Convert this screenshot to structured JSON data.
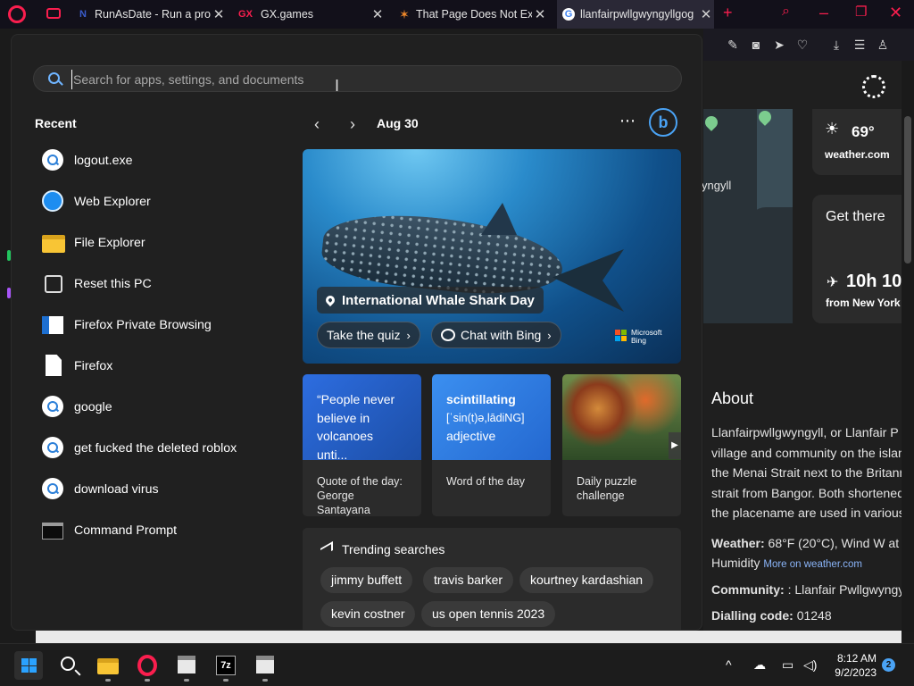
{
  "browser": {
    "tabs": [
      {
        "title": "RunAsDate - Run a prog",
        "favicon": "N",
        "favicon_color": "#3a5ccc"
      },
      {
        "title": "GX.games",
        "favicon": "GX",
        "favicon_color": "#fa1e4e"
      },
      {
        "title": "That Page Does Not Exis",
        "favicon": "✶",
        "favicon_color": "#f28a2a"
      },
      {
        "title": "llanfairpwllgwyngyllgog",
        "favicon": "G",
        "favicon_color": "#4285f4",
        "active": true
      }
    ],
    "new_tab": "+",
    "close": "✕"
  },
  "search": {
    "placeholder": "Search for apps, settings, and documents",
    "value": ""
  },
  "recent": {
    "title": "Recent",
    "items": [
      {
        "label": "logout.exe",
        "icon": "search-icon"
      },
      {
        "label": "Web Explorer",
        "icon": "web-explorer-icon"
      },
      {
        "label": "File Explorer",
        "icon": "folder-icon"
      },
      {
        "label": "Reset this PC",
        "icon": "reset-icon"
      },
      {
        "label": "Firefox Private Browsing",
        "icon": "app-icon"
      },
      {
        "label": "Firefox",
        "icon": "document-icon"
      },
      {
        "label": "google",
        "icon": "search-icon"
      },
      {
        "label": "get fucked the deleted roblox",
        "icon": "search-icon"
      },
      {
        "label": "download virus",
        "icon": "search-icon"
      },
      {
        "label": "Command Prompt",
        "icon": "cmd-icon"
      }
    ]
  },
  "highlights": {
    "date": "Aug 30",
    "more": "⋯",
    "hero": {
      "title": "International Whale Shark Day",
      "quiz": "Take the quiz",
      "chat": "Chat with Bing",
      "brand": "Microsoft Bing"
    },
    "tiles": {
      "quote": {
        "text": "“People never believe in volcanoes unti...",
        "label": "Quote of the day:",
        "author": "George Santayana"
      },
      "word": {
        "word": "scintillating",
        "pronunciation": "[ˈsin(t)ə,lādiNG]",
        "pos": "adjective",
        "label": "Word of the day"
      },
      "puzzle": {
        "label": "Daily puzzle challenge"
      }
    },
    "trending": {
      "title": "Trending searches",
      "items": [
        "jimmy buffett",
        "travis barker",
        "kourtney kardashian",
        "kevin costner",
        "us open tennis 2023"
      ]
    }
  },
  "page_bg": {
    "map_label": "yngyll",
    "weather_temp": "69°",
    "weather_source": "weather.com",
    "get_there": "Get there",
    "travel_time": "10h 10",
    "travel_from": "from New York",
    "about_title": "About",
    "about_lines": [
      "Llanfairpwllgwyngyll, or Llanfair P",
      "village and community on the islan",
      "the Menai Strait next to the Britann",
      "strait from Bangor. Both shortened",
      "the placename are used in various"
    ],
    "weather_label": "Weather:",
    "weather_value": "68°F (20°C), Wind W at",
    "humidity": "Humidity",
    "more_weather": "More on weather.com",
    "community_label": "Community:",
    "community_value": ": Llanfair Pwllgwyngy",
    "dialling_label": "Dialling code:",
    "dialling_value": "01248"
  },
  "taskbar": {
    "time": "8:12 AM",
    "date": "9/2/2023",
    "notifications": "2",
    "sevenzip": "7z"
  }
}
